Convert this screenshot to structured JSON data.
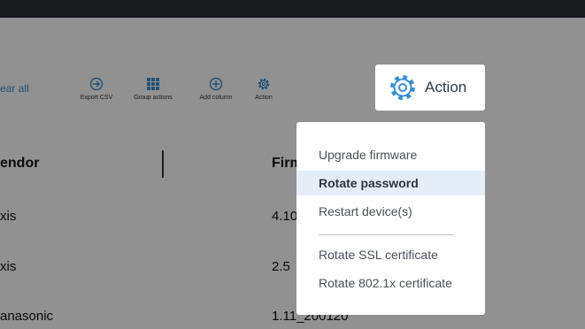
{
  "toolbar": {
    "clear_all": "ear all",
    "buttons": [
      {
        "label": "Export CSV",
        "icon": "arrow-right-circle-icon"
      },
      {
        "label": "Group actions",
        "icon": "grid-icon"
      },
      {
        "label": "Add column",
        "icon": "plus-circle-icon"
      },
      {
        "label": "Action",
        "icon": "gear-icon"
      }
    ],
    "accent_color": "#3a8fcf"
  },
  "table": {
    "columns": [
      "endor",
      "Firm"
    ],
    "rows": [
      {
        "vendor": "xis",
        "firmware": "4.10"
      },
      {
        "vendor": "xis",
        "firmware": "2.5"
      },
      {
        "vendor": "anasonic",
        "firmware": "1.11_200120"
      }
    ]
  },
  "action_button": {
    "label": "Action",
    "icon": "gear-icon"
  },
  "action_menu": {
    "items": [
      {
        "label": "Upgrade firmware",
        "highlighted": false
      },
      {
        "label": "Rotate password",
        "highlighted": true
      },
      {
        "label": "Restart device(s)",
        "highlighted": false
      },
      {
        "label": "Rotate SSL certificate",
        "highlighted": false
      },
      {
        "label": "Rotate 802.1x certificate",
        "highlighted": false
      }
    ],
    "highlight_color": "#e3eef8"
  }
}
